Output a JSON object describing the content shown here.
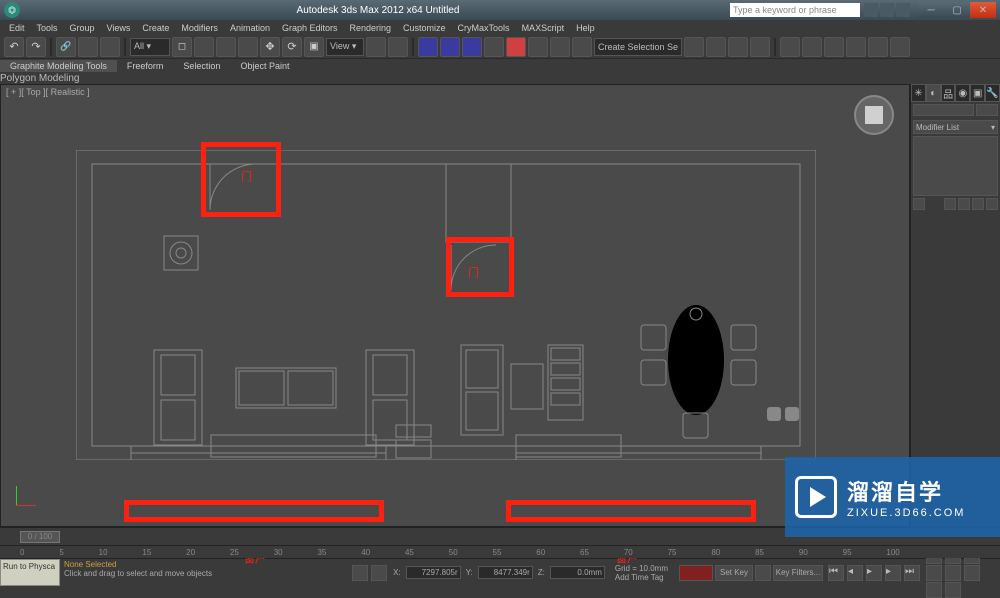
{
  "titlebar": {
    "app_icon_text": "⏣",
    "title": "Autodesk 3ds Max 2012 x64   Untitled",
    "search_placeholder": "Type a keyword or phrase"
  },
  "menu": [
    "Edit",
    "Tools",
    "Group",
    "Views",
    "Create",
    "Modifiers",
    "Animation",
    "Graph Editors",
    "Rendering",
    "Customize",
    "CryMaxTools",
    "MAXScript",
    "Help"
  ],
  "toolbar_dropdown": "Create Selection Se",
  "ribbon": {
    "tabs": [
      "Graphite Modeling Tools",
      "Freeform",
      "Selection",
      "Object Paint"
    ],
    "sub": "Polygon Modeling"
  },
  "viewport": {
    "label": "[ + ][ Top ][ Realistic ]"
  },
  "annotations": {
    "door1": "门",
    "door2": "门",
    "window1": "窗户",
    "window2": "窗户"
  },
  "cmdpanel": {
    "dropdown": "Modifier List"
  },
  "timeslider": {
    "handle": "0 / 100",
    "ticks": [
      "0",
      "5",
      "10",
      "15",
      "20",
      "25",
      "30",
      "35",
      "40",
      "45",
      "50",
      "55",
      "60",
      "65",
      "70",
      "75",
      "80",
      "85",
      "90",
      "95",
      "100"
    ]
  },
  "status": {
    "script_btn": "Run to Physca",
    "line1": "None Selected",
    "line2": "Click and drag to select and move objects",
    "x": "7297.805r",
    "y": "8477.349r",
    "z": "0.0mm",
    "grid": "Grid = 10.0mm",
    "addtimetag": "Add Time Tag",
    "setkey": "Set Key",
    "keyfilters": "Key Filters..."
  },
  "watermark": {
    "cn": "溜溜自学",
    "url": "ZIXUE.3D66.COM"
  }
}
